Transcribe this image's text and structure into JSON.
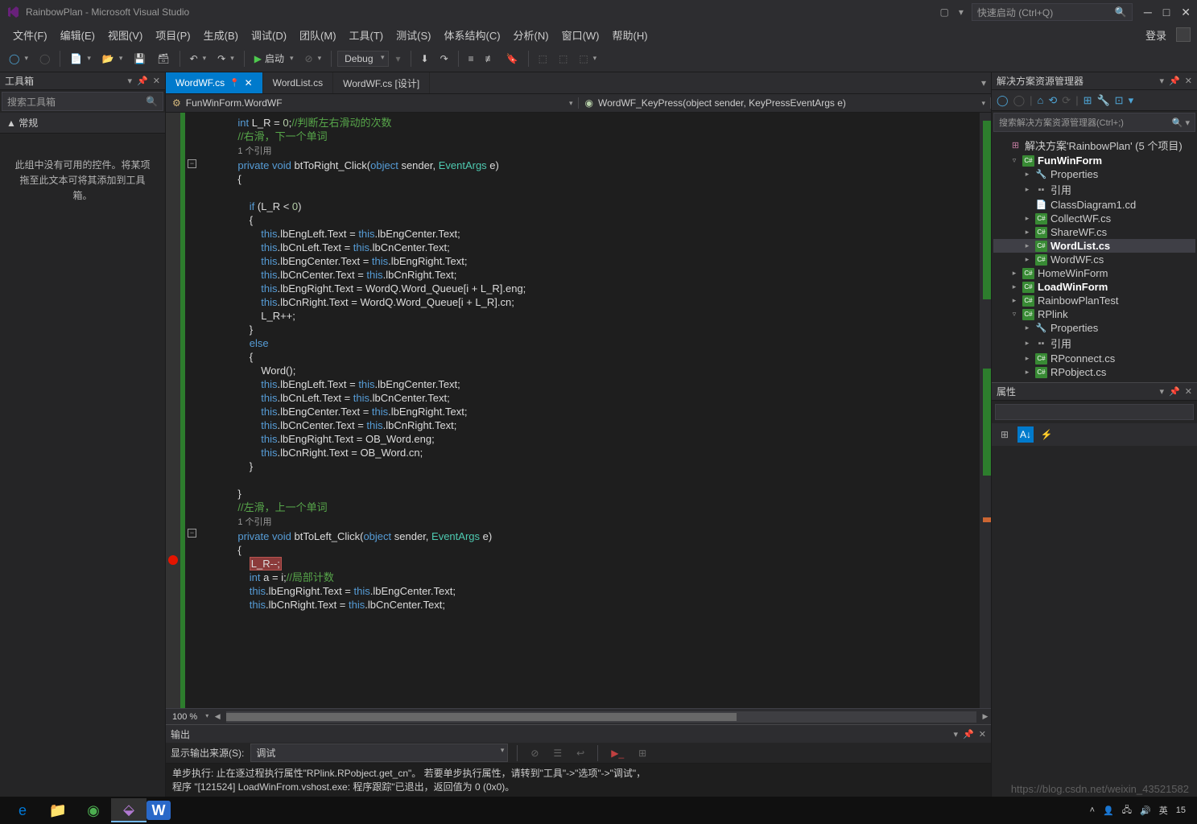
{
  "window": {
    "title": "RainbowPlan - Microsoft Visual Studio"
  },
  "titlebar": {
    "quicklaunch_placeholder": "快速启动 (Ctrl+Q)"
  },
  "menubar": {
    "items": [
      "文件(F)",
      "编辑(E)",
      "视图(V)",
      "项目(P)",
      "生成(B)",
      "调试(D)",
      "团队(M)",
      "工具(T)",
      "测试(S)",
      "体系结构(C)",
      "分析(N)",
      "窗口(W)",
      "帮助(H)"
    ],
    "signin": "登录"
  },
  "toolbar": {
    "start_label": "启动",
    "config": "Debug"
  },
  "toolbox": {
    "title": "工具箱",
    "search_placeholder": "搜索工具箱",
    "group": "▲ 常规",
    "empty_msg": "此组中没有可用的控件。将某项拖至此文本可将其添加到工具箱。"
  },
  "tabs": [
    {
      "label": "WordWF.cs",
      "active": true,
      "pinned": true,
      "close": true
    },
    {
      "label": "WordList.cs",
      "active": false
    },
    {
      "label": "WordWF.cs [设计]",
      "active": false
    }
  ],
  "navbar": {
    "left_icon": "⚙",
    "left": "FunWinForm.WordWF",
    "right_icon": "◉",
    "right": "WordWF_KeyPress(object sender, KeyPressEventArgs e)"
  },
  "code_lines": [
    {
      "html": "            <span class='k'>int</span> L_R = <span class='n'>0</span>;<span class='c'>//判断左右滑动的次数</span>"
    },
    {
      "html": "            <span class='c'>//右滑，下一个单词</span>"
    },
    {
      "html": "            <span class='ref'>1 个引用</span>"
    },
    {
      "html": "            <span class='k'>private</span> <span class='k'>void</span> btToRight_Click(<span class='k'>object</span> sender, <span class='t'>EventArgs</span> e)",
      "box": "-"
    },
    {
      "html": "            {"
    },
    {
      "html": ""
    },
    {
      "html": "                <span class='k'>if</span> (L_R &lt; <span class='n'>0</span>)"
    },
    {
      "html": "                {"
    },
    {
      "html": "                    <span class='k'>this</span>.lbEngLeft.Text = <span class='k'>this</span>.lbEngCenter.Text;"
    },
    {
      "html": "                    <span class='k'>this</span>.lbCnLeft.Text = <span class='k'>this</span>.lbCnCenter.Text;"
    },
    {
      "html": "                    <span class='k'>this</span>.lbEngCenter.Text = <span class='k'>this</span>.lbEngRight.Text;"
    },
    {
      "html": "                    <span class='k'>this</span>.lbCnCenter.Text = <span class='k'>this</span>.lbCnRight.Text;"
    },
    {
      "html": "                    <span class='k'>this</span>.lbEngRight.Text = WordQ.Word_Queue[i + L_R].eng;"
    },
    {
      "html": "                    <span class='k'>this</span>.lbCnRight.Text = WordQ.Word_Queue[i + L_R].cn;"
    },
    {
      "html": "                    L_R++;"
    },
    {
      "html": "                }"
    },
    {
      "html": "                <span class='k'>else</span>"
    },
    {
      "html": "                {"
    },
    {
      "html": "                    Word();"
    },
    {
      "html": "                    <span class='k'>this</span>.lbEngLeft.Text = <span class='k'>this</span>.lbEngCenter.Text;"
    },
    {
      "html": "                    <span class='k'>this</span>.lbCnLeft.Text = <span class='k'>this</span>.lbCnCenter.Text;"
    },
    {
      "html": "                    <span class='k'>this</span>.lbEngCenter.Text = <span class='k'>this</span>.lbEngRight.Text;"
    },
    {
      "html": "                    <span class='k'>this</span>.lbCnCenter.Text = <span class='k'>this</span>.lbCnRight.Text;"
    },
    {
      "html": "                    <span class='k'>this</span>.lbEngRight.Text = OB_Word.eng;"
    },
    {
      "html": "                    <span class='k'>this</span>.lbCnRight.Text = OB_Word.cn;"
    },
    {
      "html": "                }"
    },
    {
      "html": ""
    },
    {
      "html": "            }"
    },
    {
      "html": "            <span class='c'>//左滑，上一个单词</span>"
    },
    {
      "html": "            <span class='ref'>1 个引用</span>"
    },
    {
      "html": "            <span class='k'>private</span> <span class='k'>void</span> btToLeft_Click(<span class='k'>object</span> sender, <span class='t'>EventArgs</span> e)",
      "box": "-"
    },
    {
      "html": "            {"
    },
    {
      "html": "                <span class='hl-break'>L_R--;</span>",
      "bp": true
    },
    {
      "html": "                <span class='k'>int</span> a = i;<span class='c'>//局部计数</span>"
    },
    {
      "html": "                <span class='k'>this</span>.lbEngRight.Text = <span class='k'>this</span>.lbEngCenter.Text;"
    },
    {
      "html": "                <span class='k'>this</span>.lbCnRight.Text = <span class='k'>this</span>.lbCnCenter.Text;"
    }
  ],
  "zoom": "100 %",
  "output": {
    "title": "输出",
    "source_label": "显示输出来源(S):",
    "source_value": "调试",
    "lines": [
      "单步执行:  止在逐过程执行属性\"RPlink.RPobject.get_cn\"。 若要单步执行属性，请转到\"工具\"->\"选项\"->\"调试\"，",
      "程序 \"[121524] LoadWinFrom.vshost.exe: 程序跟踪\"已退出，返回值为 0 (0x0)。"
    ]
  },
  "solution_explorer": {
    "title": "解决方案资源管理器",
    "search_placeholder": "搜索解决方案资源管理器(Ctrl+;)",
    "root": "解决方案'RainbowPlan' (5 个项目)",
    "tree": [
      {
        "d": 1,
        "a": "▿",
        "ico": "csproj",
        "label": "FunWinForm",
        "bold": true
      },
      {
        "d": 2,
        "a": "▸",
        "ico": "prop",
        "label": "Properties"
      },
      {
        "d": 2,
        "a": "▸",
        "ico": "ref",
        "label": "引用"
      },
      {
        "d": 2,
        "a": "",
        "ico": "file",
        "label": "ClassDiagram1.cd"
      },
      {
        "d": 2,
        "a": "▸",
        "ico": "cs",
        "label": "CollectWF.cs"
      },
      {
        "d": 2,
        "a": "▸",
        "ico": "cs",
        "label": "ShareWF.cs"
      },
      {
        "d": 2,
        "a": "▸",
        "ico": "cs",
        "label": "WordList.cs",
        "bold": true,
        "sel": true
      },
      {
        "d": 2,
        "a": "▸",
        "ico": "cs",
        "label": "WordWF.cs"
      },
      {
        "d": 1,
        "a": "▸",
        "ico": "csproj",
        "label": "HomeWinForm"
      },
      {
        "d": 1,
        "a": "▸",
        "ico": "csproj",
        "label": "LoadWinForm",
        "bold": true
      },
      {
        "d": 1,
        "a": "▸",
        "ico": "csproj",
        "label": "RainbowPlanTest"
      },
      {
        "d": 1,
        "a": "▿",
        "ico": "csproj",
        "label": "RPlink"
      },
      {
        "d": 2,
        "a": "▸",
        "ico": "prop",
        "label": "Properties"
      },
      {
        "d": 2,
        "a": "▸",
        "ico": "ref",
        "label": "引用"
      },
      {
        "d": 2,
        "a": "▸",
        "ico": "cs",
        "label": "RPconnect.cs"
      },
      {
        "d": 2,
        "a": "▸",
        "ico": "cs",
        "label": "RPobject.cs"
      }
    ]
  },
  "properties": {
    "title": "属性"
  },
  "taskbar": {
    "time": "15",
    "watermark": "https://blog.csdn.net/weixin_43521582"
  }
}
